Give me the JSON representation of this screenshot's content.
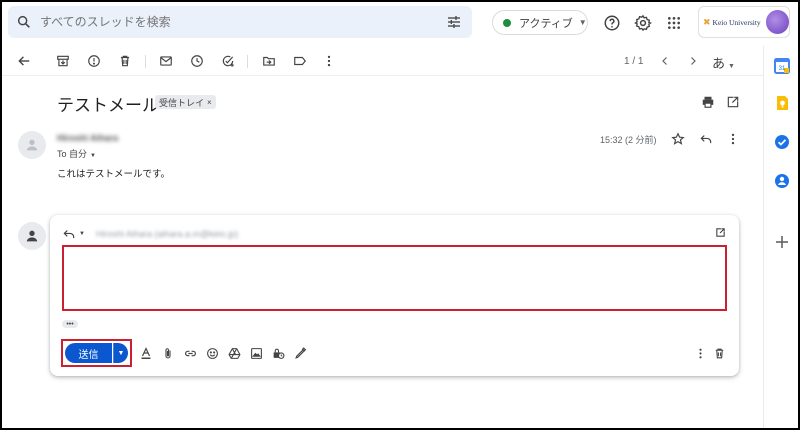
{
  "search": {
    "placeholder": "すべてのスレッドを検索"
  },
  "status": {
    "label": "アクティブ",
    "color": "#1e8e3e"
  },
  "org": {
    "name": "Keio University"
  },
  "toolbar": {
    "pager": "1 / 1",
    "language": "あ"
  },
  "email": {
    "subject": "テストメール",
    "label": "受信トレイ",
    "label_close": "×",
    "sender": "Hiroshi Aihara",
    "to": "To 自分",
    "time": "15:32 (2 分前)",
    "body": "これはテストメールです。"
  },
  "reply": {
    "recipient": "Hiroshi Aihara (aihara.a.m@keio.jp)",
    "send_label": "送信",
    "ellipsis": "•••"
  },
  "colors": {
    "accent": "#0b57d0",
    "highlight": "#cc1f2f"
  }
}
